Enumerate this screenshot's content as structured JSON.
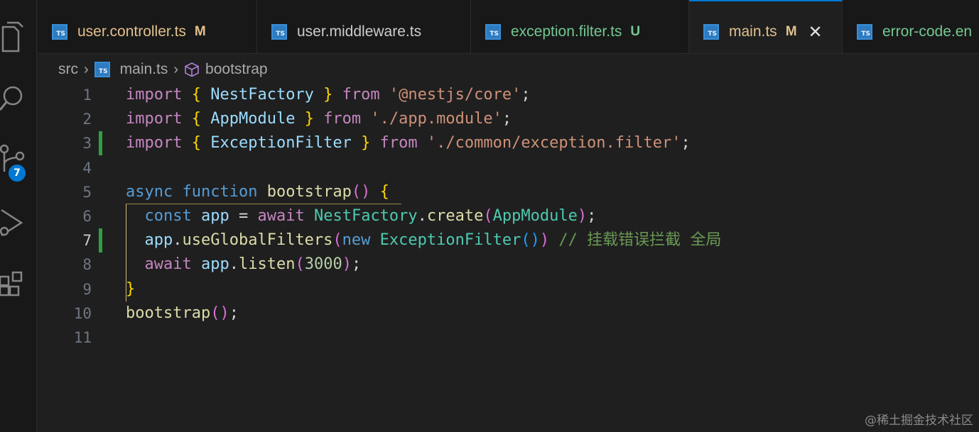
{
  "activity_bar": {
    "items": [
      "explorer-icon",
      "search-icon",
      "source-control-icon",
      "run-debug-icon",
      "extensions-icon"
    ],
    "source_control_badge": "7"
  },
  "tabs": [
    {
      "label": "user.controller.ts",
      "status": "M",
      "label_color": "#e2c08d",
      "status_color": "#e2c08d",
      "active": false
    },
    {
      "label": "user.middleware.ts",
      "status": "",
      "label_color": "#cccccc",
      "status_color": "#cccccc",
      "active": false
    },
    {
      "label": "exception.filter.ts",
      "status": "U",
      "label_color": "#73c991",
      "status_color": "#73c991",
      "active": false
    },
    {
      "label": "main.ts",
      "status": "M",
      "label_color": "#e2c08d",
      "status_color": "#e2c08d",
      "active": true,
      "close": "✕"
    },
    {
      "label": "error-code.en",
      "status": "",
      "label_color": "#73c991",
      "status_color": "#73c991",
      "active": false
    }
  ],
  "ts_icon_text": "TS",
  "breadcrumb": {
    "folder": "src",
    "file": "main.ts",
    "symbol": "bootstrap"
  },
  "editor": {
    "line_numbers": [
      "1",
      "2",
      "3",
      "4",
      "5",
      "6",
      "7",
      "8",
      "9",
      "10",
      "11"
    ],
    "current_line": 7,
    "lines": [
      [
        [
          "import",
          "kw"
        ],
        [
          " ",
          "pl"
        ],
        [
          "{",
          "b1"
        ],
        [
          " NestFactory ",
          "var"
        ],
        [
          "}",
          "b1"
        ],
        [
          " ",
          "pl"
        ],
        [
          "from",
          "kw"
        ],
        [
          " ",
          "pl"
        ],
        [
          "'@nestjs/core'",
          "str"
        ],
        [
          ";",
          "pl"
        ]
      ],
      [
        [
          "import",
          "kw"
        ],
        [
          " ",
          "pl"
        ],
        [
          "{",
          "b1"
        ],
        [
          " AppModule ",
          "var"
        ],
        [
          "}",
          "b1"
        ],
        [
          " ",
          "pl"
        ],
        [
          "from",
          "kw"
        ],
        [
          " ",
          "pl"
        ],
        [
          "'./app.module'",
          "str"
        ],
        [
          ";",
          "pl"
        ]
      ],
      [
        [
          "import",
          "kw"
        ],
        [
          " ",
          "pl"
        ],
        [
          "{",
          "b1"
        ],
        [
          " ExceptionFilter ",
          "var"
        ],
        [
          "}",
          "b1"
        ],
        [
          " ",
          "pl"
        ],
        [
          "from",
          "kw"
        ],
        [
          " ",
          "pl"
        ],
        [
          "'./common/exception.filter'",
          "str"
        ],
        [
          ";",
          "pl"
        ]
      ],
      [],
      [
        [
          "async",
          "kw2"
        ],
        [
          " ",
          "pl"
        ],
        [
          "function",
          "kw2"
        ],
        [
          " ",
          "pl"
        ],
        [
          "bootstrap",
          "fn"
        ],
        [
          "()",
          "b2"
        ],
        [
          " ",
          "pl"
        ],
        [
          "{",
          "b1"
        ]
      ],
      [
        [
          "  ",
          "pl"
        ],
        [
          "const",
          "kw2"
        ],
        [
          " ",
          "pl"
        ],
        [
          "app",
          "var"
        ],
        [
          " = ",
          "pl"
        ],
        [
          "await",
          "kw"
        ],
        [
          " ",
          "pl"
        ],
        [
          "NestFactory",
          "ty"
        ],
        [
          ".",
          "pl"
        ],
        [
          "create",
          "fn"
        ],
        [
          "(",
          "b2"
        ],
        [
          "AppModule",
          "ty"
        ],
        [
          ")",
          "b2"
        ],
        [
          ";",
          "pl"
        ]
      ],
      [
        [
          "  ",
          "pl"
        ],
        [
          "app",
          "var"
        ],
        [
          ".",
          "pl"
        ],
        [
          "useGlobalFilters",
          "fn"
        ],
        [
          "(",
          "b2"
        ],
        [
          "new",
          "kw2"
        ],
        [
          " ",
          "pl"
        ],
        [
          "ExceptionFilter",
          "ty"
        ],
        [
          "()",
          "b3"
        ],
        [
          ")",
          "b2"
        ],
        [
          " ",
          "pl"
        ],
        [
          "// 挂载错误拦截 全局",
          "cm"
        ]
      ],
      [
        [
          "  ",
          "pl"
        ],
        [
          "await",
          "kw"
        ],
        [
          " ",
          "pl"
        ],
        [
          "app",
          "var"
        ],
        [
          ".",
          "pl"
        ],
        [
          "listen",
          "fn"
        ],
        [
          "(",
          "b2"
        ],
        [
          "3000",
          "num"
        ],
        [
          ")",
          "b2"
        ],
        [
          ";",
          "pl"
        ]
      ],
      [
        [
          "}",
          "b1"
        ]
      ],
      [
        [
          "bootstrap",
          "fn"
        ],
        [
          "()",
          "b2"
        ],
        [
          ";",
          "pl"
        ]
      ],
      []
    ],
    "modified_lines": [
      3,
      7
    ]
  },
  "watermark": "@稀土掘金技术社区"
}
